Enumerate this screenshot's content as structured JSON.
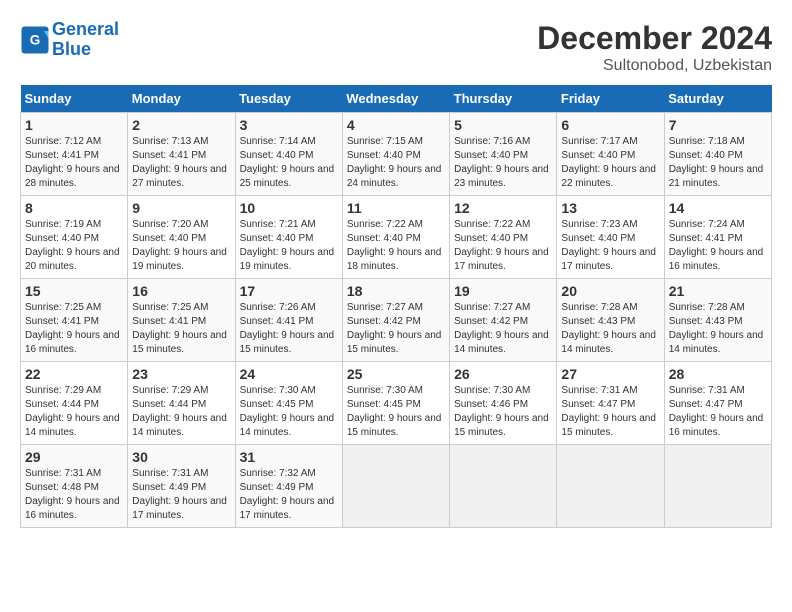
{
  "logo": {
    "line1": "General",
    "line2": "Blue"
  },
  "title": "December 2024",
  "subtitle": "Sultonobod, Uzbekistan",
  "days_header": [
    "Sunday",
    "Monday",
    "Tuesday",
    "Wednesday",
    "Thursday",
    "Friday",
    "Saturday"
  ],
  "weeks": [
    [
      {
        "day": "1",
        "sunrise": "Sunrise: 7:12 AM",
        "sunset": "Sunset: 4:41 PM",
        "daylight": "Daylight: 9 hours and 28 minutes."
      },
      {
        "day": "2",
        "sunrise": "Sunrise: 7:13 AM",
        "sunset": "Sunset: 4:41 PM",
        "daylight": "Daylight: 9 hours and 27 minutes."
      },
      {
        "day": "3",
        "sunrise": "Sunrise: 7:14 AM",
        "sunset": "Sunset: 4:40 PM",
        "daylight": "Daylight: 9 hours and 25 minutes."
      },
      {
        "day": "4",
        "sunrise": "Sunrise: 7:15 AM",
        "sunset": "Sunset: 4:40 PM",
        "daylight": "Daylight: 9 hours and 24 minutes."
      },
      {
        "day": "5",
        "sunrise": "Sunrise: 7:16 AM",
        "sunset": "Sunset: 4:40 PM",
        "daylight": "Daylight: 9 hours and 23 minutes."
      },
      {
        "day": "6",
        "sunrise": "Sunrise: 7:17 AM",
        "sunset": "Sunset: 4:40 PM",
        "daylight": "Daylight: 9 hours and 22 minutes."
      },
      {
        "day": "7",
        "sunrise": "Sunrise: 7:18 AM",
        "sunset": "Sunset: 4:40 PM",
        "daylight": "Daylight: 9 hours and 21 minutes."
      }
    ],
    [
      {
        "day": "8",
        "sunrise": "Sunrise: 7:19 AM",
        "sunset": "Sunset: 4:40 PM",
        "daylight": "Daylight: 9 hours and 20 minutes."
      },
      {
        "day": "9",
        "sunrise": "Sunrise: 7:20 AM",
        "sunset": "Sunset: 4:40 PM",
        "daylight": "Daylight: 9 hours and 19 minutes."
      },
      {
        "day": "10",
        "sunrise": "Sunrise: 7:21 AM",
        "sunset": "Sunset: 4:40 PM",
        "daylight": "Daylight: 9 hours and 19 minutes."
      },
      {
        "day": "11",
        "sunrise": "Sunrise: 7:22 AM",
        "sunset": "Sunset: 4:40 PM",
        "daylight": "Daylight: 9 hours and 18 minutes."
      },
      {
        "day": "12",
        "sunrise": "Sunrise: 7:22 AM",
        "sunset": "Sunset: 4:40 PM",
        "daylight": "Daylight: 9 hours and 17 minutes."
      },
      {
        "day": "13",
        "sunrise": "Sunrise: 7:23 AM",
        "sunset": "Sunset: 4:40 PM",
        "daylight": "Daylight: 9 hours and 17 minutes."
      },
      {
        "day": "14",
        "sunrise": "Sunrise: 7:24 AM",
        "sunset": "Sunset: 4:41 PM",
        "daylight": "Daylight: 9 hours and 16 minutes."
      }
    ],
    [
      {
        "day": "15",
        "sunrise": "Sunrise: 7:25 AM",
        "sunset": "Sunset: 4:41 PM",
        "daylight": "Daylight: 9 hours and 16 minutes."
      },
      {
        "day": "16",
        "sunrise": "Sunrise: 7:25 AM",
        "sunset": "Sunset: 4:41 PM",
        "daylight": "Daylight: 9 hours and 15 minutes."
      },
      {
        "day": "17",
        "sunrise": "Sunrise: 7:26 AM",
        "sunset": "Sunset: 4:41 PM",
        "daylight": "Daylight: 9 hours and 15 minutes."
      },
      {
        "day": "18",
        "sunrise": "Sunrise: 7:27 AM",
        "sunset": "Sunset: 4:42 PM",
        "daylight": "Daylight: 9 hours and 15 minutes."
      },
      {
        "day": "19",
        "sunrise": "Sunrise: 7:27 AM",
        "sunset": "Sunset: 4:42 PM",
        "daylight": "Daylight: 9 hours and 14 minutes."
      },
      {
        "day": "20",
        "sunrise": "Sunrise: 7:28 AM",
        "sunset": "Sunset: 4:43 PM",
        "daylight": "Daylight: 9 hours and 14 minutes."
      },
      {
        "day": "21",
        "sunrise": "Sunrise: 7:28 AM",
        "sunset": "Sunset: 4:43 PM",
        "daylight": "Daylight: 9 hours and 14 minutes."
      }
    ],
    [
      {
        "day": "22",
        "sunrise": "Sunrise: 7:29 AM",
        "sunset": "Sunset: 4:44 PM",
        "daylight": "Daylight: 9 hours and 14 minutes."
      },
      {
        "day": "23",
        "sunrise": "Sunrise: 7:29 AM",
        "sunset": "Sunset: 4:44 PM",
        "daylight": "Daylight: 9 hours and 14 minutes."
      },
      {
        "day": "24",
        "sunrise": "Sunrise: 7:30 AM",
        "sunset": "Sunset: 4:45 PM",
        "daylight": "Daylight: 9 hours and 14 minutes."
      },
      {
        "day": "25",
        "sunrise": "Sunrise: 7:30 AM",
        "sunset": "Sunset: 4:45 PM",
        "daylight": "Daylight: 9 hours and 15 minutes."
      },
      {
        "day": "26",
        "sunrise": "Sunrise: 7:30 AM",
        "sunset": "Sunset: 4:46 PM",
        "daylight": "Daylight: 9 hours and 15 minutes."
      },
      {
        "day": "27",
        "sunrise": "Sunrise: 7:31 AM",
        "sunset": "Sunset: 4:47 PM",
        "daylight": "Daylight: 9 hours and 15 minutes."
      },
      {
        "day": "28",
        "sunrise": "Sunrise: 7:31 AM",
        "sunset": "Sunset: 4:47 PM",
        "daylight": "Daylight: 9 hours and 16 minutes."
      }
    ],
    [
      {
        "day": "29",
        "sunrise": "Sunrise: 7:31 AM",
        "sunset": "Sunset: 4:48 PM",
        "daylight": "Daylight: 9 hours and 16 minutes."
      },
      {
        "day": "30",
        "sunrise": "Sunrise: 7:31 AM",
        "sunset": "Sunset: 4:49 PM",
        "daylight": "Daylight: 9 hours and 17 minutes."
      },
      {
        "day": "31",
        "sunrise": "Sunrise: 7:32 AM",
        "sunset": "Sunset: 4:49 PM",
        "daylight": "Daylight: 9 hours and 17 minutes."
      },
      null,
      null,
      null,
      null
    ]
  ]
}
